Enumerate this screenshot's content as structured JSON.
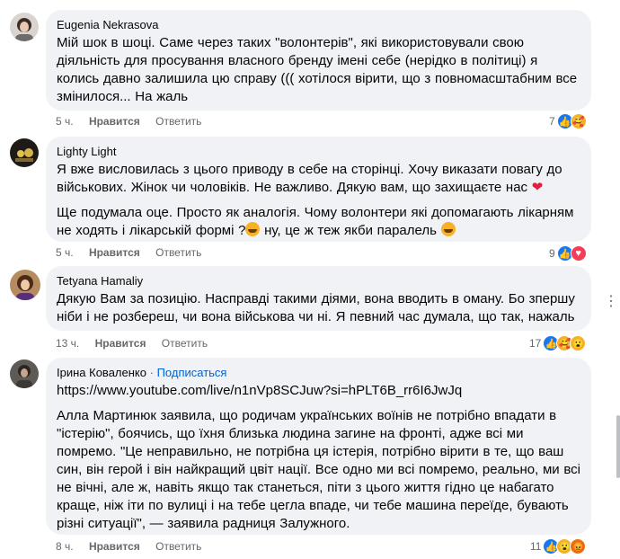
{
  "comments": [
    {
      "author": "Eugenia Nekrasova",
      "text": "Мій шок в шоці. Саме через таких \"волонтерів\", які використовували свою діяльність для просування власного бренду імені себе (нерідко в політиці) я колись давно залишила цю справу ((( хотілося вірити, що з повномасштабним все змінилося... На жаль",
      "time": "5 ч.",
      "like": "Нравится",
      "reply": "Ответить",
      "reaction_count": "7",
      "reactions": [
        "like-icon",
        "care-icon"
      ]
    },
    {
      "author": "Lighty Light",
      "paragraph1": "Я вже висловилась з цього приводу в себе на сторінці. Хочу виказати повагу до військових. Жінок чи чоловіків. Не важливо. Дякую вам, що захищаєте нас",
      "paragraph2": "Ще подумала оце. Просто як аналогія. Чому волонтери які допомагають лікарням не ходять і лікарській формі ?",
      "paragraph2b": "ну, це ж теж якби паралель",
      "time": "5 ч.",
      "like": "Нравится",
      "reply": "Ответить",
      "reaction_count": "9",
      "reactions": [
        "like-icon",
        "love-icon"
      ]
    },
    {
      "author": "Tetyana Hamaliy",
      "text": "Дякую Вам за позицію. Насправді такими діями, вона вводить в оману. Бо зпершу ніби і не розбереш, чи вона військова чи ні. Я певний час думала, що так, нажаль",
      "time": "13 ч.",
      "like": "Нравится",
      "reply": "Ответить",
      "reaction_count": "17",
      "reactions": [
        "like-icon",
        "care-icon",
        "wow-icon"
      ]
    },
    {
      "author": "Ірина Коваленко",
      "separator": "·",
      "follow": "Подписаться",
      "link": "https://www.youtube.com/live/n1nVp8SCJuw?si=hPLT6B_rr6I6JwJq",
      "text": "Алла Мартинюк заявила, що родичам українських воїнів не потрібно впадати в \"істерію\", боячись, що їхня близька людина загине на фронті, адже всі ми помремо. \"Це неправильно, не потрібна ця істерія, потрібно вірити в те, що ваш син, він герой і він найкращий цвіт нації. Все одно ми всі помремо, реально, ми всі не вічні, але ж, навіть якщо так станеться, піти з цього життя гідно це набагато краще, ніж іти по вулиці і на тебе цегла впаде, чи тебе машина переїде, бувають різні ситуації\", — заявила радниця Залужного.",
      "time": "8 ч.",
      "like": "Нравится",
      "reply": "Ответить",
      "reaction_count": "11",
      "reactions": [
        "like-icon",
        "wow-icon",
        "angry-icon"
      ]
    }
  ],
  "more": "⋮"
}
